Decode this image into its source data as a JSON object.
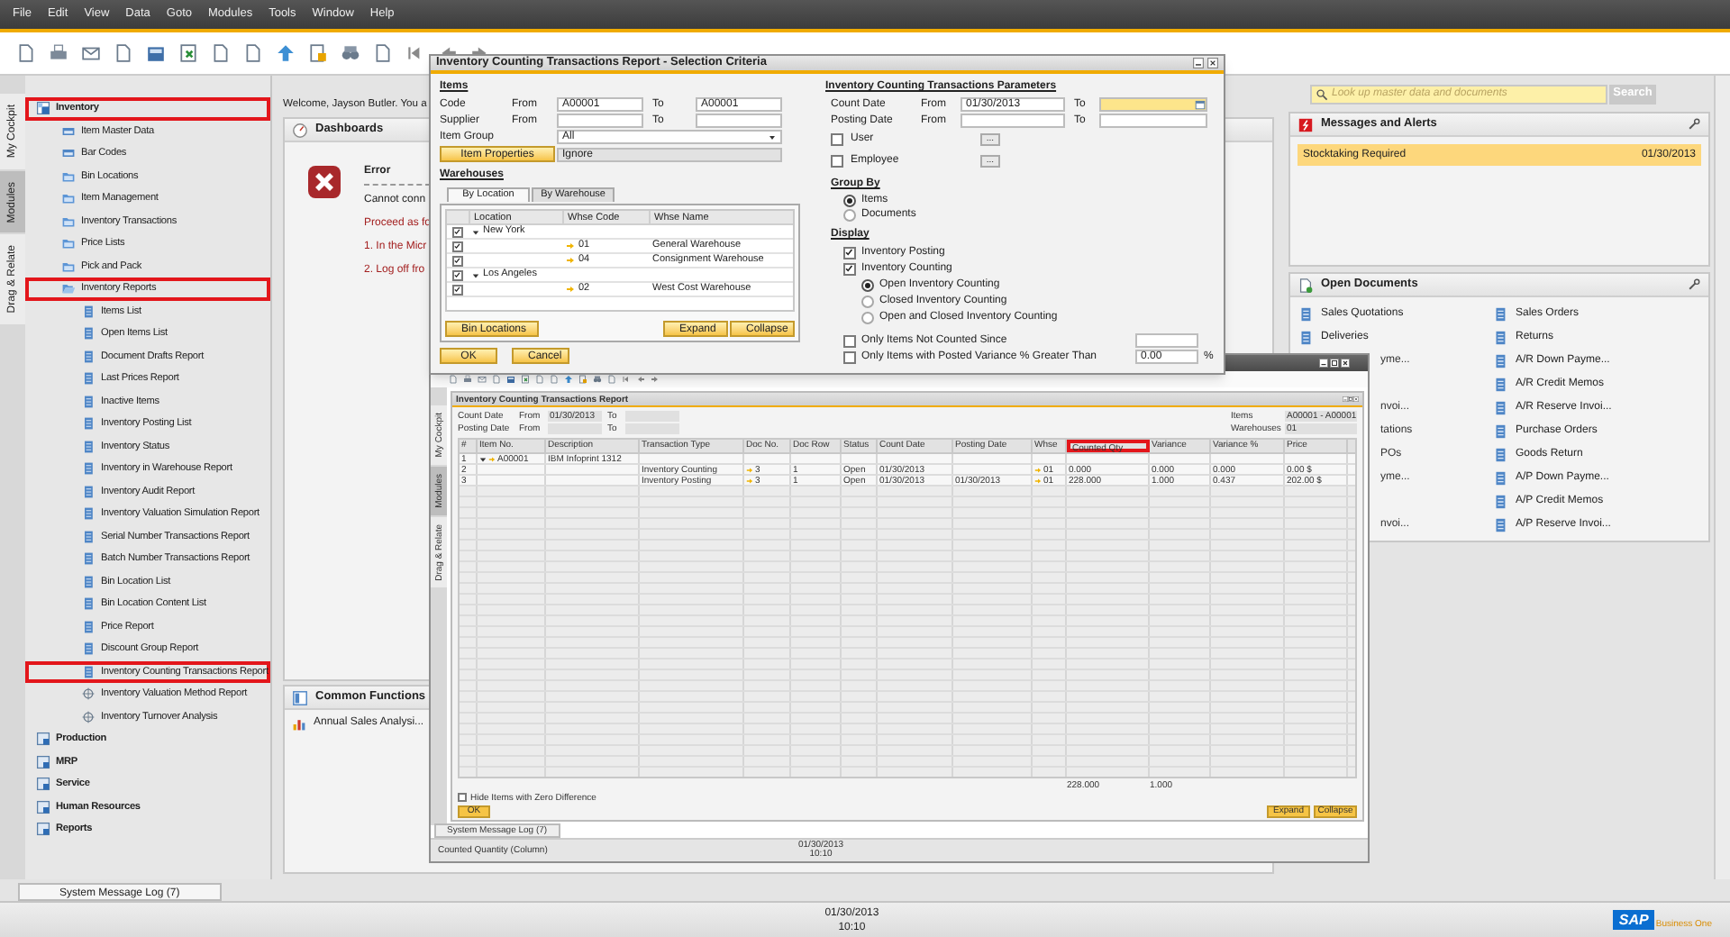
{
  "menu": [
    "File",
    "Edit",
    "View",
    "Data",
    "Goto",
    "Modules",
    "Tools",
    "Window",
    "Help"
  ],
  "sidebar_tabs": [
    {
      "label": "My Cockpit",
      "selected": false
    },
    {
      "label": "Modules",
      "selected": true
    },
    {
      "label": "Drag & Relate",
      "selected": false
    }
  ],
  "tree": [
    {
      "label": "Inventory",
      "kind": "module",
      "highlighted": true,
      "expanded": true,
      "children": [
        {
          "label": "Item Master Data",
          "kind": "form",
          "highlighted": false
        },
        {
          "label": "Bar Codes",
          "kind": "form",
          "highlighted": false
        },
        {
          "label": "Bin Locations",
          "kind": "folder",
          "highlighted": false
        },
        {
          "label": "Item Management",
          "kind": "folder",
          "highlighted": false
        },
        {
          "label": "Inventory Transactions",
          "kind": "folder",
          "highlighted": false
        },
        {
          "label": "Price Lists",
          "kind": "folder",
          "highlighted": false
        },
        {
          "label": "Pick and Pack",
          "kind": "folder",
          "highlighted": false
        },
        {
          "label": "Inventory Reports",
          "kind": "folder",
          "highlighted": true,
          "expanded": true,
          "children": [
            {
              "label": "Items List",
              "kind": "report",
              "highlighted": false
            },
            {
              "label": "Open Items List",
              "kind": "report",
              "highlighted": false
            },
            {
              "label": "Document Drafts Report",
              "kind": "report",
              "highlighted": false
            },
            {
              "label": "Last Prices Report",
              "kind": "report",
              "highlighted": false
            },
            {
              "label": "Inactive Items",
              "kind": "report",
              "highlighted": false
            },
            {
              "label": "Inventory Posting List",
              "kind": "report",
              "highlighted": false
            },
            {
              "label": "Inventory Status",
              "kind": "report",
              "highlighted": false
            },
            {
              "label": "Inventory in Warehouse Report",
              "kind": "report",
              "highlighted": false
            },
            {
              "label": "Inventory Audit Report",
              "kind": "report",
              "highlighted": false
            },
            {
              "label": "Inventory Valuation Simulation Report",
              "kind": "report",
              "highlighted": false
            },
            {
              "label": "Serial Number Transactions Report",
              "kind": "report",
              "highlighted": false
            },
            {
              "label": "Batch Number Transactions Report",
              "kind": "report",
              "highlighted": false
            },
            {
              "label": "Bin Location List",
              "kind": "report",
              "highlighted": false
            },
            {
              "label": "Bin Location Content List",
              "kind": "report",
              "highlighted": false
            },
            {
              "label": "Price Report",
              "kind": "report",
              "highlighted": false
            },
            {
              "label": "Discount Group Report",
              "kind": "report",
              "highlighted": false
            },
            {
              "label": "Inventory Counting Transactions Report",
              "kind": "report",
              "highlighted": true
            },
            {
              "label": "Inventory Valuation Method Report",
              "kind": "query",
              "highlighted": false
            },
            {
              "label": "Inventory Turnover Analysis",
              "kind": "query",
              "highlighted": false
            }
          ]
        }
      ]
    },
    {
      "label": "Production",
      "kind": "module",
      "highlighted": false
    },
    {
      "label": "MRP",
      "kind": "module",
      "highlighted": false
    },
    {
      "label": "Service",
      "kind": "module",
      "highlighted": false
    },
    {
      "label": "Human Resources",
      "kind": "module",
      "highlighted": false
    },
    {
      "label": "Reports",
      "kind": "module",
      "highlighted": false
    }
  ],
  "welcome": "Welcome, Jayson Butler. You a",
  "search": {
    "placeholder": "Look up master data and documents",
    "button": "Search"
  },
  "dashboards": {
    "title": "Dashboards",
    "error_title": "Error",
    "lines": [
      {
        "text": "Cannot conn",
        "kind": "plain"
      },
      {
        "text": "Proceed as fo",
        "kind": "alert"
      },
      {
        "text": "1. In the Micr",
        "kind": "alert"
      },
      {
        "text": "2. Log off fro",
        "kind": "alert"
      }
    ]
  },
  "common_functions": {
    "title": "Common Functions",
    "items": [
      "Annual Sales Analysi..."
    ]
  },
  "messages": {
    "title": "Messages and Alerts",
    "items": [
      {
        "text": "Stocktaking Required",
        "date": "01/30/2013",
        "selected": true
      }
    ]
  },
  "open_documents": {
    "title": "Open Documents",
    "rows": [
      {
        "left": {
          "label": "Sales Quotations",
          "partial": false
        },
        "right": {
          "label": "Sales Orders"
        }
      },
      {
        "left": {
          "label": "Deliveries",
          "partial": false
        },
        "right": {
          "label": "Returns"
        }
      },
      {
        "left": {
          "label": "yme...",
          "partial": true
        },
        "right": {
          "label": "A/R Down Payme..."
        }
      },
      {
        "right": {
          "label": "A/R Credit Memos"
        }
      },
      {
        "left": {
          "label": "nvoi...",
          "partial": true
        },
        "right": {
          "label": "A/R Reserve Invoi..."
        }
      },
      {
        "left": {
          "label": "tations",
          "partial": true
        },
        "right": {
          "label": "Purchase Orders"
        }
      },
      {
        "left": {
          "label": "POs",
          "partial": true
        },
        "right": {
          "label": "Goods Return"
        }
      },
      {
        "left": {
          "label": "yme...",
          "partial": true
        },
        "right": {
          "label": "A/P Down Payme..."
        }
      },
      {
        "right": {
          "label": "A/P Credit Memos"
        }
      },
      {
        "left": {
          "label": "nvoi...",
          "partial": true
        },
        "right": {
          "label": "A/P Reserve Invoi..."
        }
      }
    ]
  },
  "selection_dialog": {
    "title": "Inventory Counting Transactions Report - Selection Criteria",
    "items_heading": "Items",
    "item_fields": [
      {
        "label": "Code",
        "from_label": "From",
        "from": "A00001",
        "to_label": "To",
        "to": "A00001"
      },
      {
        "label": "Supplier",
        "from_label": "From",
        "to_label": "To"
      }
    ],
    "item_group": {
      "label": "Item Group",
      "value": "All"
    },
    "item_properties": {
      "button": "Item Properties",
      "value": "Ignore"
    },
    "warehouses_heading": "Warehouses",
    "tabs": [
      {
        "label": "By Location",
        "selected": true
      },
      {
        "label": "By Warehouse",
        "selected": false
      }
    ],
    "warehouse_columns": [
      "Location",
      "Whse Code",
      "Whse Name"
    ],
    "warehouse_rows": [
      {
        "location": "New York",
        "checked": true,
        "expanded": true,
        "children": [
          {
            "code": "01",
            "name": "General Warehouse",
            "checked": true
          },
          {
            "code": "04",
            "name": "Consignment Warehouse",
            "checked": true
          }
        ]
      },
      {
        "location": "Los Angeles",
        "checked": true,
        "expanded": true,
        "children": [
          {
            "code": "02",
            "name": "West Cost Warehouse",
            "checked": true
          }
        ]
      }
    ],
    "bin_button": "Bin Locations",
    "expand_button": "Expand",
    "collapse_button": "Collapse",
    "ok_button": "OK",
    "cancel_button": "Cancel",
    "params_heading": "Inventory Counting Transactions Parameters",
    "date_fields": [
      {
        "label": "Count Date",
        "from_label": "From",
        "from": "01/30/2013",
        "to_label": "To",
        "focused": true
      },
      {
        "label": "Posting Date",
        "from_label": "From",
        "to_label": "To",
        "focused": false
      }
    ],
    "people": [
      {
        "label": "User",
        "checked": false,
        "button": "..."
      },
      {
        "label": "Employee",
        "checked": false,
        "button": "..."
      }
    ],
    "group_by": {
      "heading": "Group By",
      "options": [
        {
          "label": "Items",
          "selected": true
        },
        {
          "label": "Documents",
          "selected": false
        }
      ]
    },
    "display": {
      "heading": "Display",
      "options": [
        {
          "label": "Inventory Posting",
          "checked": true
        },
        {
          "label": "Inventory Counting",
          "checked": true
        }
      ],
      "counting_options": [
        {
          "label": "Open Inventory Counting",
          "selected": true
        },
        {
          "label": "Closed Inventory Counting",
          "selected": false
        },
        {
          "label": "Open and Closed Inventory Counting",
          "selected": false
        }
      ]
    },
    "filters": [
      {
        "label": "Only Items Not Counted Since",
        "checked": false
      },
      {
        "label": "Only Items with Posted Variance % Greater Than",
        "checked": false,
        "value": "0.00",
        "unit": "%"
      }
    ]
  },
  "report_window": {
    "sidebar_tabs": [
      {
        "label": "My Cockpit",
        "selected": false
      },
      {
        "label": "Modules",
        "selected": true
      },
      {
        "label": "Drag & Relate",
        "selected": false
      }
    ],
    "title": "Inventory Counting Transactions Report",
    "criteria": [
      {
        "label": "Count Date",
        "from_label": "From",
        "from": "01/30/2013",
        "to_label": "To"
      },
      {
        "label": "Posting Date",
        "from_label": "From",
        "to_label": "To"
      }
    ],
    "summary": [
      {
        "label": "Items",
        "value": "A00001 - A00001"
      },
      {
        "label": "Warehouses",
        "value": "01"
      }
    ],
    "columns": [
      {
        "label": "#",
        "highlighted": false
      },
      {
        "label": "Item No.",
        "highlighted": false
      },
      {
        "label": "Description",
        "highlighted": false
      },
      {
        "label": "Transaction Type",
        "highlighted": false
      },
      {
        "label": "Doc No.",
        "highlighted": false
      },
      {
        "label": "Doc Row",
        "highlighted": false
      },
      {
        "label": "Status",
        "highlighted": false
      },
      {
        "label": "Count Date",
        "highlighted": false
      },
      {
        "label": "Posting Date",
        "highlighted": false
      },
      {
        "label": "Whse",
        "highlighted": false
      },
      {
        "label": "Counted Qty",
        "highlighted": true
      },
      {
        "label": "Variance",
        "highlighted": false
      },
      {
        "label": "Variance %",
        "highlighted": false
      },
      {
        "label": "Price",
        "highlighted": false
      }
    ],
    "rows": [
      {
        "num": "1",
        "item_no": "A00001",
        "description": "IBM Infoprint 1312"
      },
      {
        "num": "2",
        "transaction_type": "Inventory Counting",
        "doc_no": "3",
        "doc_row": "1",
        "status": "Open",
        "count_date": "01/30/2013",
        "whse": "01",
        "counted_qty": "0.000",
        "variance": "0.000",
        "variance_pct": "0.000",
        "price": "0.00 $"
      },
      {
        "num": "3",
        "transaction_type": "Inventory Posting",
        "doc_no": "3",
        "doc_row": "1",
        "status": "Open",
        "count_date": "01/30/2013",
        "posting_date": "01/30/2013",
        "whse": "01",
        "counted_qty": "228.000",
        "variance": "1.000",
        "variance_pct": "0.437",
        "price": "202.00 $"
      }
    ],
    "totals": {
      "counted_qty": "228.000",
      "variance": "1.000"
    },
    "hide_zero": {
      "label": "Hide Items with Zero Difference",
      "checked": false
    },
    "ok_button": "OK",
    "expand_button": "Expand",
    "collapse_button": "Collapse",
    "status_tab": "System Message Log (7)",
    "status_text": "Counted Quantity (Column)",
    "date": "01/30/2013",
    "time": "10:10"
  },
  "bottom_tabs": [
    "System Message Log (7)"
  ],
  "status_bar": {
    "date": "01/30/2013",
    "time": "10:10"
  },
  "logo": {
    "brand": "SAP",
    "product": "Business One"
  }
}
